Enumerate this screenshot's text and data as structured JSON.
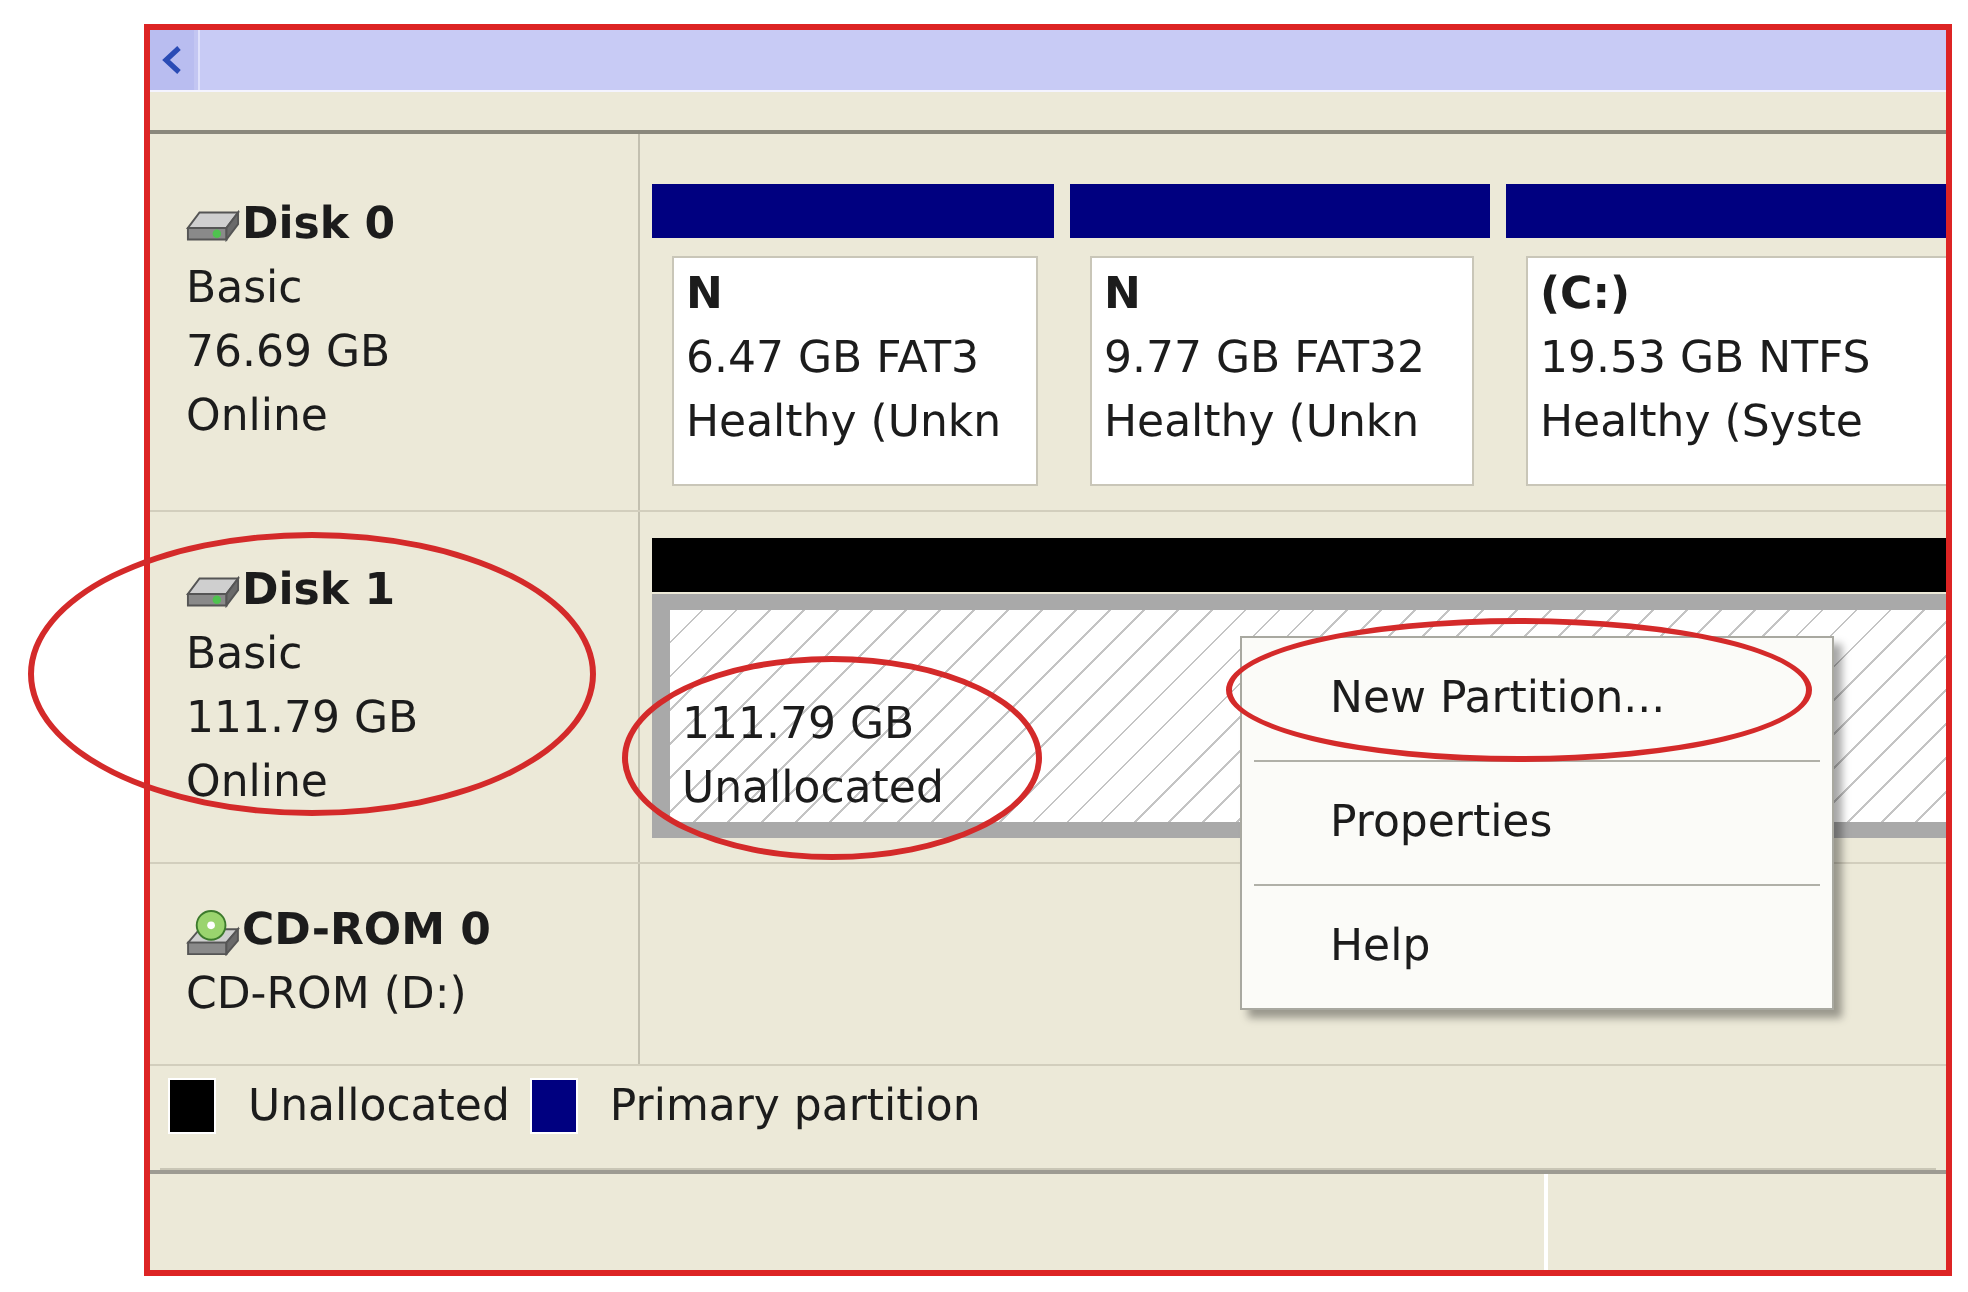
{
  "disks": [
    {
      "kind": "disk",
      "name": "Disk 0",
      "type": "Basic",
      "size": "76.69 GB",
      "status": "Online",
      "circled": false,
      "partitions": [
        {
          "kind": "primary",
          "label": "N",
          "capacity": "6.47 GB FAT3",
          "status": "Healthy (Unkn",
          "circled": false
        },
        {
          "kind": "primary",
          "label": "N",
          "capacity": "9.77 GB FAT32",
          "status": "Healthy (Unkn",
          "circled": false
        },
        {
          "kind": "primary",
          "label": "(C:)",
          "capacity": "19.53 GB NTFS",
          "status": "Healthy (Syste",
          "circled": false
        }
      ]
    },
    {
      "kind": "disk",
      "name": "Disk 1",
      "type": "Basic",
      "size": "111.79 GB",
      "status": "Online",
      "circled": true,
      "partitions": [
        {
          "kind": "unallocated",
          "capacity": "111.79 GB",
          "status": "Unallocated",
          "circled": true
        }
      ]
    },
    {
      "kind": "cdrom",
      "name": "CD-ROM 0",
      "type": "CD-ROM (D:)",
      "circled": false
    }
  ],
  "legend": [
    {
      "label": "Unallocated",
      "color": "#000000"
    },
    {
      "label": "Primary partition",
      "color": "#000080"
    }
  ],
  "context_menu": {
    "items": [
      {
        "label": "New Partition...",
        "circled": true
      },
      {
        "label": "Properties",
        "circled": false
      },
      {
        "label": "Help",
        "circled": false
      }
    ]
  }
}
